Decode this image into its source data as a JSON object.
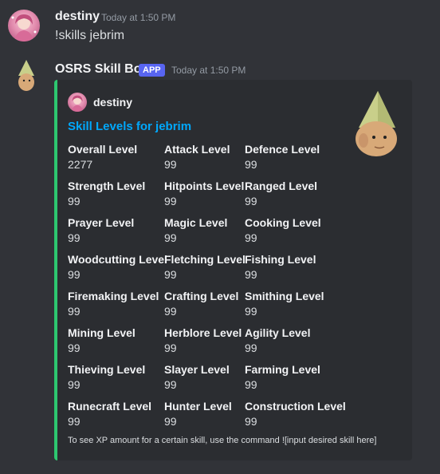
{
  "message1": {
    "username": "destiny",
    "timestamp": "Today at 1:50 PM",
    "content": "!skills jebrim"
  },
  "message2": {
    "username": "OSRS Skill Bot",
    "badge": "APP",
    "timestamp": "Today at 1:50 PM",
    "embed": {
      "author": "destiny",
      "title": "Skill Levels for jebrim",
      "accent_color": "#2dc770",
      "fields": [
        {
          "name": "Overall Level",
          "value": "2277"
        },
        {
          "name": "Attack Level",
          "value": "99"
        },
        {
          "name": "Defence Level",
          "value": "99"
        },
        {
          "name": "Strength Level",
          "value": "99"
        },
        {
          "name": "Hitpoints Level",
          "value": "99"
        },
        {
          "name": "Ranged Level",
          "value": "99"
        },
        {
          "name": "Prayer Level",
          "value": "99"
        },
        {
          "name": "Magic Level",
          "value": "99"
        },
        {
          "name": "Cooking Level",
          "value": "99"
        },
        {
          "name": "Woodcutting Level",
          "value": "99"
        },
        {
          "name": "Fletching Level",
          "value": "99"
        },
        {
          "name": "Fishing Level",
          "value": "99"
        },
        {
          "name": "Firemaking Level",
          "value": "99"
        },
        {
          "name": "Crafting Level",
          "value": "99"
        },
        {
          "name": "Smithing Level",
          "value": "99"
        },
        {
          "name": "Mining Level",
          "value": "99"
        },
        {
          "name": "Herblore Level",
          "value": "99"
        },
        {
          "name": "Agility Level",
          "value": "99"
        },
        {
          "name": "Thieving Level",
          "value": "99"
        },
        {
          "name": "Slayer Level",
          "value": "99"
        },
        {
          "name": "Farming Level",
          "value": "99"
        },
        {
          "name": "Runecraft Level",
          "value": "99"
        },
        {
          "name": "Hunter Level",
          "value": "99"
        },
        {
          "name": "Construction Level",
          "value": "99"
        }
      ],
      "footer": "To see XP amount for a certain skill, use the command ![input desired skill here]"
    }
  }
}
